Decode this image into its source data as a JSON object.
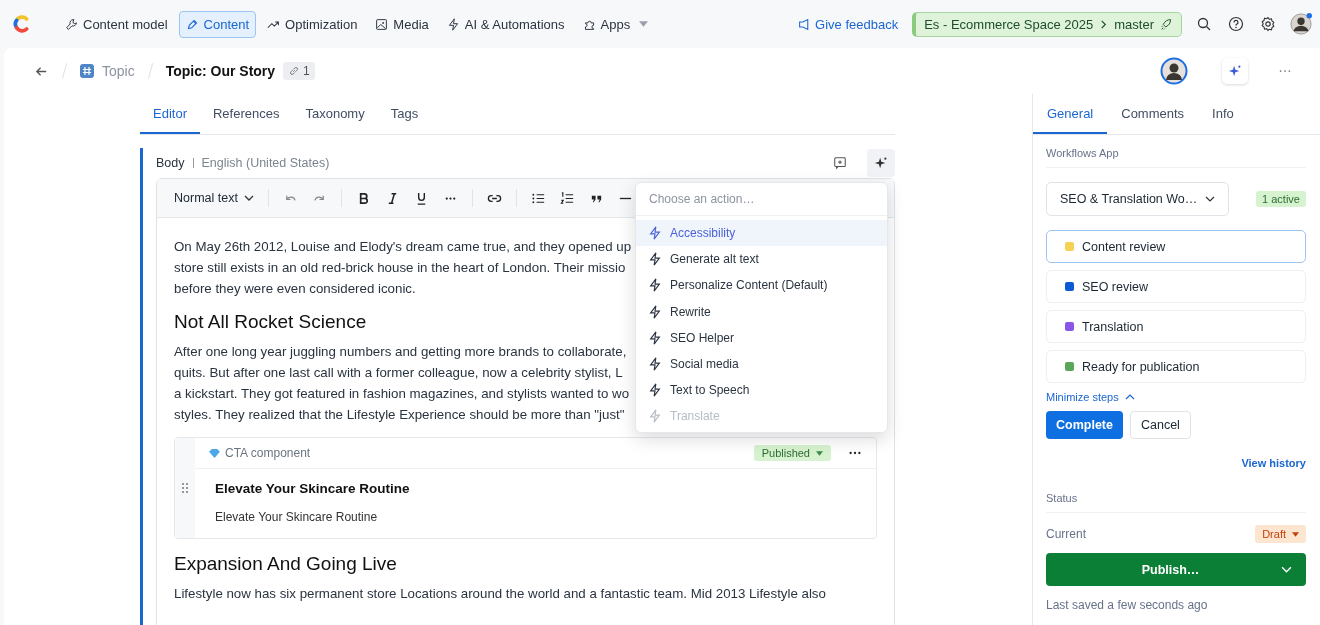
{
  "nav": {
    "items": [
      {
        "label": "Content model",
        "selected": false
      },
      {
        "label": "Content",
        "selected": true
      },
      {
        "label": "Optimization",
        "selected": false
      },
      {
        "label": "Media",
        "selected": false
      },
      {
        "label": "AI & Automations",
        "selected": false
      },
      {
        "label": "Apps",
        "selected": false
      }
    ],
    "feedback": "Give feedback",
    "space": "Es - Ecommerce Space 2025",
    "environment": "master"
  },
  "header": {
    "parent": "Topic",
    "title": "Topic: Our Story",
    "links": "1"
  },
  "tabs": [
    {
      "label": "Editor",
      "selected": true
    },
    {
      "label": "References",
      "selected": false
    },
    {
      "label": "Taxonomy",
      "selected": false
    },
    {
      "label": "Tags",
      "selected": false
    }
  ],
  "field": {
    "label": "Body",
    "locale": "English (United States)",
    "format": "Normal text"
  },
  "content": [
    {
      "kind": "paragraph",
      "lines": [
        "On May 26th 2012, Louise and Elody's dream came true, and they opened up",
        "store still exists in an old red-brick house in the heart of London. Their missio",
        "before they were even considered iconic."
      ]
    },
    {
      "kind": "heading",
      "lines": [
        "Not All Rocket Science"
      ]
    },
    {
      "kind": "paragraph",
      "lines": [
        "After one long year juggling numbers and getting more brands to collaborate,",
        "quits. But after one last call with a former colleague, now a celebrity stylist, L",
        "a kickstart. They got featured in fashion magazines, and stylists wanted to wo",
        "styles. They realized that the Lifestyle Experience should be more than \"just\""
      ]
    },
    {
      "kind": "embed",
      "type_label": "CTA component",
      "status": "Published",
      "title": "Elevate Your Skincare Routine",
      "text": "Elevate Your Skincare Routine"
    },
    {
      "kind": "heading",
      "lines": [
        "Expansion And Going Live"
      ]
    },
    {
      "kind": "paragraph",
      "lines": [
        "Lifestyle now has six permanent store Locations around the world and a fantastic team. Mid 2013 Lifestyle also"
      ]
    }
  ],
  "action_menu": {
    "placeholder": "Choose an action…",
    "items": [
      {
        "label": "Accessibility",
        "selected": true,
        "disabled": false
      },
      {
        "label": "Generate alt text",
        "selected": false,
        "disabled": false
      },
      {
        "label": "Personalize Content (Default)",
        "selected": false,
        "disabled": false
      },
      {
        "label": "Rewrite",
        "selected": false,
        "disabled": false
      },
      {
        "label": "SEO Helper",
        "selected": false,
        "disabled": false
      },
      {
        "label": "Social media",
        "selected": false,
        "disabled": false
      },
      {
        "label": "Text to Speech",
        "selected": false,
        "disabled": false
      },
      {
        "label": "Translate",
        "selected": false,
        "disabled": true
      }
    ]
  },
  "sidebar": {
    "tabs": [
      {
        "label": "General",
        "selected": true
      },
      {
        "label": "Comments",
        "selected": false
      },
      {
        "label": "Info",
        "selected": false
      }
    ],
    "workflows": {
      "heading": "Workflows App",
      "workflow": "SEO & Translation Wo…",
      "badge": "1 active",
      "steps": [
        {
          "label": "Content review",
          "color": "#f7d154",
          "selected": true
        },
        {
          "label": "SEO review",
          "color": "#0b5ad5",
          "selected": false
        },
        {
          "label": "Translation",
          "color": "#8a56e8",
          "selected": false
        },
        {
          "label": "Ready for publication",
          "color": "#5aa65a",
          "selected": false
        }
      ],
      "minimize": "Minimize steps",
      "complete": "Complete",
      "cancel": "Cancel",
      "history": "View history"
    },
    "status": {
      "heading": "Status",
      "current_label": "Current",
      "current": "Draft",
      "publish": "Publish…",
      "saved": "Last saved a few seconds ago"
    }
  }
}
